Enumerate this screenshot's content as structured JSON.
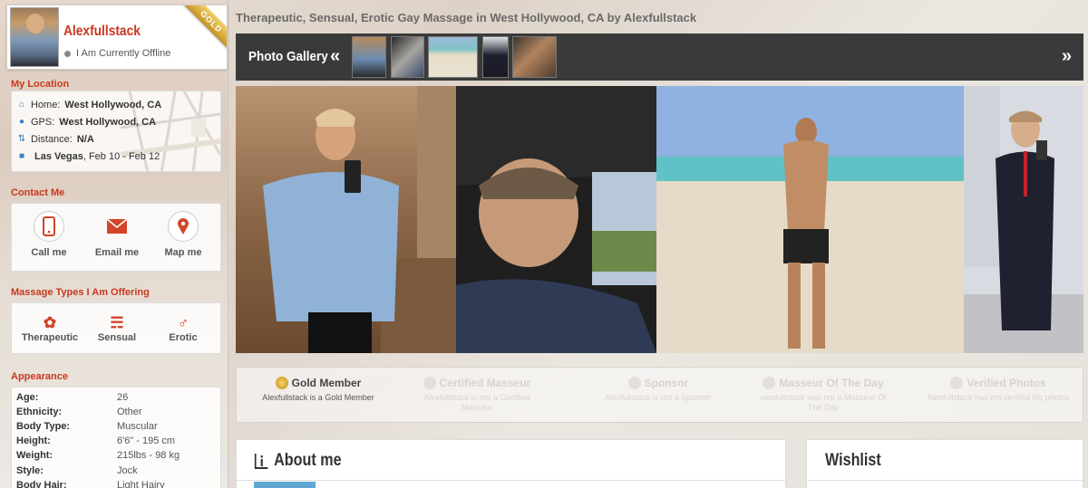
{
  "profile": {
    "name": "Alexfullstack",
    "status": "I Am Currently Offline",
    "badge": "GOLD"
  },
  "location": {
    "section_title": "My Location",
    "home_label": "Home:",
    "home_value": "West Hollywood, CA",
    "gps_label": "GPS:",
    "gps_value": "West Hollywood, CA",
    "distance_label": "Distance:",
    "distance_value": "N/A",
    "travel_city": "Las Vegas",
    "travel_dates": ", Feb 10 - Feb 12"
  },
  "contact": {
    "section_title": "Contact Me",
    "call_label": "Call me",
    "email_label": "Email me",
    "map_label": "Map me"
  },
  "massage_types": {
    "section_title": "Massage Types I Am Offering",
    "items": [
      "Therapeutic",
      "Sensual",
      "Erotic"
    ]
  },
  "appearance": {
    "section_title": "Appearance",
    "rows": [
      {
        "key": "Age:",
        "value": "26"
      },
      {
        "key": "Ethnicity:",
        "value": "Other"
      },
      {
        "key": "Body Type:",
        "value": "Muscular"
      },
      {
        "key": "Height:",
        "value": "6'6\" - 195 cm"
      },
      {
        "key": "Weight:",
        "value": "215lbs - 98 kg"
      },
      {
        "key": "Style:",
        "value": "Jock"
      },
      {
        "key": "Body Hair:",
        "value": "Light Hairy"
      }
    ]
  },
  "page_title": "Therapeutic, Sensual, Erotic Gay Massage in West Hollywood, CA by Alexfullstack",
  "gallery": {
    "label": "Photo Gallery",
    "prev": "«",
    "next": "»"
  },
  "badges": [
    {
      "title": "Gold Member",
      "subtitle": "Alexfullstack is a Gold Member",
      "active": true
    },
    {
      "title": "Certified Masseur",
      "subtitle": "Alexfullstack is not a Certified Masseur",
      "active": false
    },
    {
      "title": "Sponsor",
      "subtitle": "Alexfullstack is not a Sponsor",
      "active": false
    },
    {
      "title": "Masseur Of The Day",
      "subtitle": "alexfullstack was not a Masseur Of The Day",
      "active": false
    },
    {
      "title": "Verified Photos",
      "subtitle": "Alexfullstack has not verified his photos",
      "active": false
    }
  ],
  "about": {
    "title": "About me"
  },
  "wishlist": {
    "title": "Wishlist"
  },
  "colors": {
    "accent": "#c8381f",
    "gallery_bar": "#3a3a3a",
    "icon_red": "#d2452a",
    "gold": "#d9a520"
  }
}
